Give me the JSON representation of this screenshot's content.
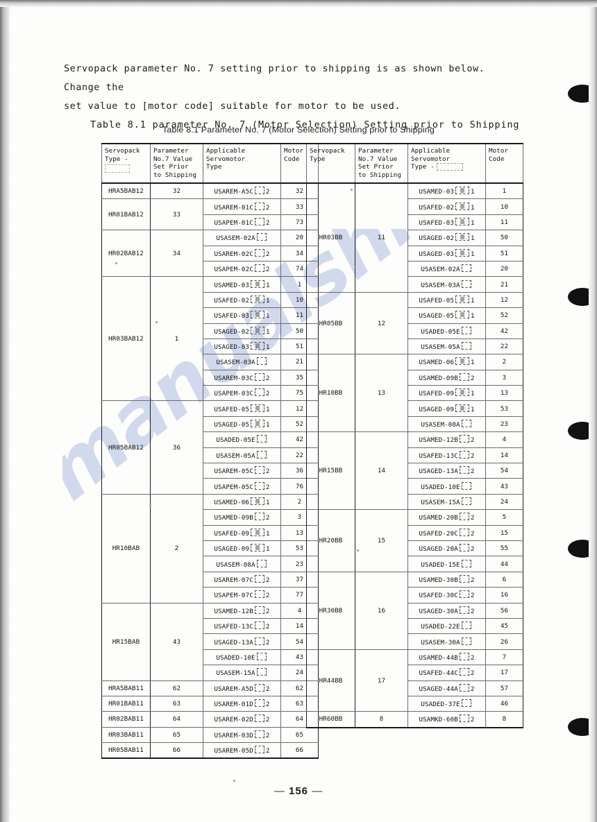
{
  "page": {
    "number": "156",
    "dash_left": "—",
    "dash_right": "—",
    "watermark": "manualshive.com"
  },
  "intro": {
    "line1": "Servopack parameter No. 7 setting prior to shipping is as shown below.   Change the",
    "line2": "set value to [motor code] suitable for motor to be used.",
    "line3": "Table 8.1 parameter No. 7 (Motor Selection) Setting prior to Shipping"
  },
  "table_caption": "Table 8.1  Parameter No. 7  (Motor Selection)   Setting prior to Shipping",
  "headers": {
    "servopack_type": "Servopack Type -",
    "servopack_type_right": "Servopack Type",
    "parameter_value": "Parameter No.7 Value Set Prior to Shipping",
    "parameter_value_lines": [
      "Parameter",
      "No.7 Value",
      "Set Prior",
      "to Shipping"
    ],
    "applicable_type": "Applicable Servomotor Type",
    "applicable_type_lines": [
      "Applicable",
      "Servomotor",
      "Type"
    ],
    "applicable_type_right_lines": [
      "Applicable",
      "Servomotor",
      "Type -"
    ],
    "motor_code": "Motor Code",
    "motor_code_lines": [
      "Motor",
      "Code"
    ]
  },
  "left_table": [
    {
      "servopack": "HRA5BAB12",
      "value": "32",
      "rows": [
        {
          "type": "USAREM-A5C",
          "ph": "small",
          "suffix": "2",
          "code": "32"
        }
      ]
    },
    {
      "servopack": "HR01BAB12",
      "value": "33",
      "rows": [
        {
          "type": "USAREM-01C",
          "ph": "small",
          "suffix": "2",
          "code": "33"
        },
        {
          "type": "USAPEM-01C",
          "ph": "small",
          "suffix": "2",
          "code": "73"
        }
      ]
    },
    {
      "servopack": "HR02BAB12",
      "value": "34",
      "rows": [
        {
          "type": "USASEM-02A",
          "ph": "small",
          "suffix": "",
          "code": "20"
        },
        {
          "type": "USAREM-02C",
          "ph": "small",
          "suffix": "2",
          "code": "34"
        },
        {
          "type": "USAPEM-02C",
          "ph": "small",
          "suffix": "2",
          "code": "74"
        }
      ]
    },
    {
      "servopack": "HR03BAB12",
      "value": "1",
      "rows": [
        {
          "type": "USAMED-03",
          "ph": "wide",
          "suffix": "1",
          "code": "1"
        },
        {
          "type": "USAFED-02",
          "ph": "wide",
          "suffix": "1",
          "code": "10"
        },
        {
          "type": "USAFED-03",
          "ph": "wide",
          "suffix": "1",
          "code": "11"
        },
        {
          "type": "USAGED-02",
          "ph": "wide",
          "suffix": "1",
          "code": "50"
        },
        {
          "type": "USAGED-03",
          "ph": "wide",
          "suffix": "1",
          "code": "51"
        },
        {
          "type": "USASEM-03A",
          "ph": "small",
          "suffix": "",
          "code": "21"
        },
        {
          "type": "USAREM-03C",
          "ph": "small",
          "suffix": "2",
          "code": "35"
        },
        {
          "type": "USAPEM-03C",
          "ph": "small",
          "suffix": "2",
          "code": "75"
        }
      ]
    },
    {
      "servopack": "HR05BAB12",
      "value": "36",
      "rows": [
        {
          "type": "USAFED-05",
          "ph": "wide",
          "suffix": "1",
          "code": "12"
        },
        {
          "type": "USAGED-05",
          "ph": "wide",
          "suffix": "1",
          "code": "52"
        },
        {
          "type": "USADED-05E",
          "ph": "small",
          "suffix": "",
          "code": "42"
        },
        {
          "type": "USASEM-05A",
          "ph": "small",
          "suffix": "",
          "code": "22"
        },
        {
          "type": "USAREM-05C",
          "ph": "small",
          "suffix": "2",
          "code": "36"
        },
        {
          "type": "USAPEM-05C",
          "ph": "small",
          "suffix": "2",
          "code": "76"
        }
      ]
    },
    {
      "servopack": "HR10BAB",
      "value": "2",
      "rows": [
        {
          "type": "USAMED-06",
          "ph": "wide",
          "suffix": "1",
          "code": "2"
        },
        {
          "type": "USAMED-09B",
          "ph": "small",
          "suffix": "2",
          "code": "3"
        },
        {
          "type": "USAFED-09",
          "ph": "wide",
          "suffix": "1",
          "code": "13"
        },
        {
          "type": "USAGED-09",
          "ph": "wide",
          "suffix": "1",
          "code": "53"
        },
        {
          "type": "USASEM-08A",
          "ph": "small",
          "suffix": "",
          "code": "23"
        },
        {
          "type": "USAREM-07C",
          "ph": "small",
          "suffix": "2",
          "code": "37"
        },
        {
          "type": "USAPEM-07C",
          "ph": "small",
          "suffix": "2",
          "code": "77"
        }
      ]
    },
    {
      "servopack": "HR15BAB",
      "value": "43",
      "rows": [
        {
          "type": "USAMED-12B",
          "ph": "small",
          "suffix": "2",
          "code": "4"
        },
        {
          "type": "USAFED-13C",
          "ph": "small",
          "suffix": "2",
          "code": "14"
        },
        {
          "type": "USAGED-13A",
          "ph": "small",
          "suffix": "2",
          "code": "54"
        },
        {
          "type": "USADED-10E",
          "ph": "small",
          "suffix": "",
          "code": "43"
        },
        {
          "type": "USASEM-15A",
          "ph": "small",
          "suffix": "",
          "code": "24"
        }
      ]
    },
    {
      "servopack": "HRA5BAB11",
      "value": "62",
      "rows": [
        {
          "type": "USAREM-A5D",
          "ph": "small",
          "suffix": "2",
          "code": "62"
        }
      ]
    },
    {
      "servopack": "HR01BAB11",
      "value": "63",
      "rows": [
        {
          "type": "USAREM-01D",
          "ph": "small",
          "suffix": "2",
          "code": "63"
        }
      ]
    },
    {
      "servopack": "HR02BAB11",
      "value": "64",
      "rows": [
        {
          "type": "USAREM-02D",
          "ph": "small",
          "suffix": "2",
          "code": "64"
        }
      ]
    },
    {
      "servopack": "HR03BAB11",
      "value": "65",
      "rows": [
        {
          "type": "USAREM-03D",
          "ph": "small",
          "suffix": "2",
          "code": "65"
        }
      ]
    },
    {
      "servopack": "HR05BAB11",
      "value": "66",
      "rows": [
        {
          "type": "USAREM-05D",
          "ph": "small",
          "suffix": "2",
          "code": "66"
        }
      ]
    }
  ],
  "right_table": [
    {
      "servopack": "HR03BB",
      "value": "11",
      "rows": [
        {
          "type": "USAMED-03",
          "ph": "wide",
          "suffix": "1",
          "code": "1"
        },
        {
          "type": "USAFED-02",
          "ph": "wide",
          "suffix": "1",
          "code": "10"
        },
        {
          "type": "USAFED-03",
          "ph": "wide",
          "suffix": "1",
          "code": "11"
        },
        {
          "type": "USAGED-02",
          "ph": "wide",
          "suffix": "1",
          "code": "50"
        },
        {
          "type": "USAGED-03",
          "ph": "wide",
          "suffix": "1",
          "code": "51"
        },
        {
          "type": "USASEM-02A",
          "ph": "small",
          "suffix": "",
          "code": "20"
        },
        {
          "type": "USASEM-03A",
          "ph": "small",
          "suffix": "",
          "code": "21"
        }
      ]
    },
    {
      "servopack": "HR05BB",
      "value": "12",
      "rows": [
        {
          "type": "USAFED-05",
          "ph": "wide",
          "suffix": "1",
          "code": "12"
        },
        {
          "type": "USAGED-05",
          "ph": "wide",
          "suffix": "1",
          "code": "52"
        },
        {
          "type": "USADED-05E",
          "ph": "small",
          "suffix": "",
          "code": "42"
        },
        {
          "type": "USASEM-05A",
          "ph": "small",
          "suffix": "",
          "code": "22"
        }
      ]
    },
    {
      "servopack": "HR10BB",
      "value": "13",
      "rows": [
        {
          "type": "USAMED-06",
          "ph": "wide",
          "suffix": "1",
          "code": "2"
        },
        {
          "type": "USAMED-09B",
          "ph": "small",
          "suffix": "2",
          "code": "3"
        },
        {
          "type": "USAFED-09",
          "ph": "wide",
          "suffix": "1",
          "code": "13"
        },
        {
          "type": "USAGED-09",
          "ph": "wide",
          "suffix": "1",
          "code": "53"
        },
        {
          "type": "USASEM-08A",
          "ph": "small",
          "suffix": "",
          "code": "23"
        }
      ]
    },
    {
      "servopack": "HR15BB",
      "value": "14",
      "rows": [
        {
          "type": "USAMED-12B",
          "ph": "small",
          "suffix": "2",
          "code": "4"
        },
        {
          "type": "USAFED-13C",
          "ph": "small",
          "suffix": "2",
          "code": "14"
        },
        {
          "type": "USAGED-13A",
          "ph": "small",
          "suffix": "2",
          "code": "54"
        },
        {
          "type": "USADED-10E",
          "ph": "small",
          "suffix": "",
          "code": "43"
        },
        {
          "type": "USASEM-15A",
          "ph": "small",
          "suffix": "",
          "code": "24"
        }
      ]
    },
    {
      "servopack": "HR20BB",
      "value": "15",
      "rows": [
        {
          "type": "USAMED-20B",
          "ph": "small",
          "suffix": "2",
          "code": "5"
        },
        {
          "type": "USAFED-20C",
          "ph": "small",
          "suffix": "2",
          "code": "15"
        },
        {
          "type": "USAGED-20A",
          "ph": "small",
          "suffix": "2",
          "code": "55"
        },
        {
          "type": "USADED-15E",
          "ph": "small",
          "suffix": "",
          "code": "44"
        }
      ]
    },
    {
      "servopack": "HR30BB",
      "value": "16",
      "rows": [
        {
          "type": "USAMED-30B",
          "ph": "small",
          "suffix": "2",
          "code": "6"
        },
        {
          "type": "USAFED-30C",
          "ph": "small",
          "suffix": "2",
          "code": "16"
        },
        {
          "type": "USAGED-30A",
          "ph": "small",
          "suffix": "2",
          "code": "56"
        },
        {
          "type": "USADED-22E",
          "ph": "small",
          "suffix": "",
          "code": "45"
        },
        {
          "type": "USASEM-30A",
          "ph": "small",
          "suffix": "",
          "code": "26"
        }
      ]
    },
    {
      "servopack": "HR44BB",
      "value": "17",
      "rows": [
        {
          "type": "USAMED-44B",
          "ph": "small",
          "suffix": "2",
          "code": "7"
        },
        {
          "type": "USAFED-44C",
          "ph": "small",
          "suffix": "2",
          "code": "17"
        },
        {
          "type": "USAGED-44A",
          "ph": "small",
          "suffix": "2",
          "code": "57"
        },
        {
          "type": "USADED-37E",
          "ph": "small",
          "suffix": "",
          "code": "46"
        }
      ]
    },
    {
      "servopack": "HR60BB",
      "value": "8",
      "rows": [
        {
          "type": "USAMKD-60B",
          "ph": "small",
          "suffix": "2",
          "code": "8"
        }
      ]
    }
  ]
}
